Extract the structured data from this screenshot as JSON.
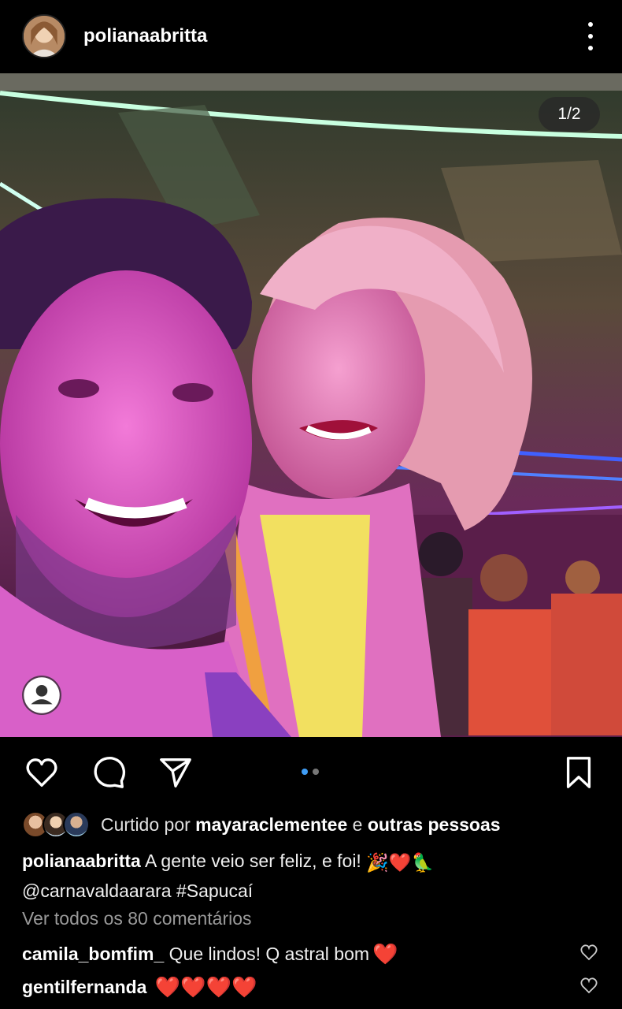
{
  "post": {
    "username": "polianaabritta",
    "counter": "1/2",
    "avatar_icon": "profile-avatar",
    "menu_icon": "more-vertical-icon"
  },
  "actions": {
    "like_icon": "heart-outline-icon",
    "comment_icon": "comment-bubble-icon",
    "share_icon": "paper-plane-icon",
    "save_icon": "bookmark-icon",
    "carousel_pages": 2,
    "carousel_active": 1
  },
  "likes": {
    "prefix": "Curtido por",
    "user": "mayaraclementee",
    "conj": "e",
    "others": "outras pessoas"
  },
  "caption": {
    "user": "polianaabritta",
    "text": "A gente veio ser feliz, e foi!",
    "emojis": "🎉❤️🦜",
    "mention": "@carnavaldaarara",
    "hashtag": "#Sapucaí"
  },
  "comments": {
    "view_all": "Ver todos os 80 comentários",
    "items": [
      {
        "user": "camila_bomfim_",
        "text": "Que lindos! Q astral bom",
        "emoji": "❤️"
      },
      {
        "user": "gentilfernanda",
        "text": "",
        "emoji": "❤️❤️❤️❤️"
      }
    ]
  },
  "colors": {
    "background": "#000000",
    "text": "#f5f5f5",
    "muted": "#9a9a9a",
    "accent_dot": "#3f9df5",
    "heart_red": "#e53935"
  }
}
